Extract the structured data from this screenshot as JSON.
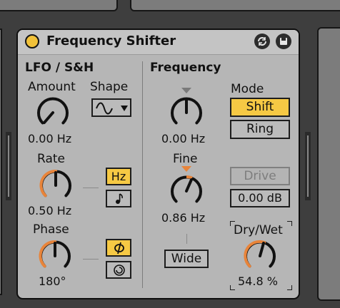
{
  "device": {
    "title": "Frequency Shifter",
    "colors": {
      "accent": "#f6c944",
      "knob_arc": "#e8843a",
      "body": "#b6b6b6",
      "dark": "#111111"
    },
    "header_icons": [
      "hot-swap-icon",
      "save-preset-icon"
    ]
  },
  "lfo": {
    "section_label": "LFO / S&H",
    "amount": {
      "label": "Amount",
      "value": "0.00 Hz",
      "level": 0.0
    },
    "shape": {
      "label": "Shape",
      "selected": "sine-wave-icon"
    },
    "rate": {
      "label": "Rate",
      "value": "0.50 Hz",
      "level": 0.5,
      "unit_hz": "Hz",
      "unit_sync_icon": "note-icon"
    },
    "phase": {
      "label": "Phase",
      "value": "180°",
      "level": 0.5,
      "phase_icon": "phi-icon",
      "spin_icon": "spin-icon"
    }
  },
  "frequency": {
    "section_label": "Frequency",
    "coarse": {
      "value": "0.00 Hz",
      "level": 0.0
    },
    "fine": {
      "label": "Fine",
      "value": "0.86 Hz",
      "level": 0.43
    },
    "wide_label": "Wide"
  },
  "mode": {
    "label": "Mode",
    "shift_label": "Shift",
    "ring_label": "Ring",
    "selected": "Shift"
  },
  "drive": {
    "label": "Drive",
    "value": "0.00 dB"
  },
  "dry_wet": {
    "label": "Dry/Wet",
    "value": "54.8 %",
    "level": 0.548
  }
}
